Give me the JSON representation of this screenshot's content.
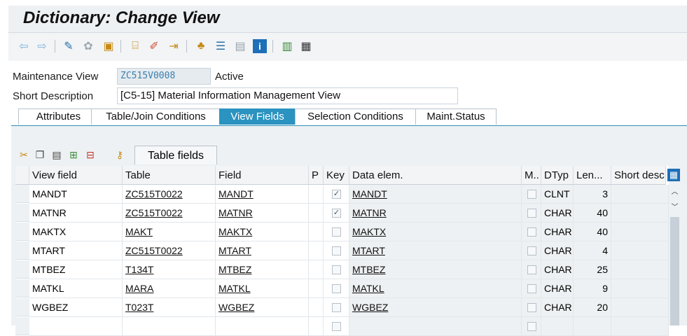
{
  "window": {
    "title": "Dictionary: Change View"
  },
  "toolbar": {
    "icons": [
      "back-arrow-icon",
      "forward-arrow-icon",
      "other-object-icon",
      "display-change-icon",
      "activate-icon",
      "where-used-icon",
      "navigation-object-icon",
      "generate-icon",
      "hierarchy-icon",
      "stack-icon",
      "layout-icon",
      "info-icon",
      "technical-settings-icon",
      "table-layout-icon"
    ]
  },
  "header": {
    "maintenance_view_label": "Maintenance View",
    "maintenance_view_value": "ZC515V0008",
    "status": "Active",
    "short_description_label": "Short Description",
    "short_description_value": "[C5-15] Material Information Management View"
  },
  "tabs": [
    {
      "label": "Attributes",
      "active": false
    },
    {
      "label": "Table/Join Conditions",
      "active": false
    },
    {
      "label": "View Fields",
      "active": true
    },
    {
      "label": "Selection Conditions",
      "active": false
    },
    {
      "label": "Maint.Status",
      "active": false
    }
  ],
  "panel": {
    "table_fields_label": "Table fields"
  },
  "grid": {
    "columns": [
      "View field",
      "Table",
      "Field",
      "P",
      "Key",
      "Data elem.",
      "M..",
      "DTyp",
      "Len...",
      "Short desc"
    ],
    "rows": [
      {
        "view_field": "MANDT",
        "table": "ZC515T0022",
        "field": "MANDT",
        "key": true,
        "data_elem": "MANDT",
        "dtyp": "CLNT",
        "len": "3"
      },
      {
        "view_field": "MATNR",
        "table": "ZC515T0022",
        "field": "MATNR",
        "key": true,
        "data_elem": "MATNR",
        "dtyp": "CHAR",
        "len": "40"
      },
      {
        "view_field": "MAKTX",
        "table": "MAKT",
        "field": "MAKTX",
        "key": false,
        "data_elem": "MAKTX",
        "dtyp": "CHAR",
        "len": "40"
      },
      {
        "view_field": "MTART",
        "table": "ZC515T0022",
        "field": "MTART",
        "key": false,
        "data_elem": "MTART",
        "dtyp": "CHAR",
        "len": "4"
      },
      {
        "view_field": "MTBEZ",
        "table": "T134T",
        "field": "MTBEZ",
        "key": false,
        "data_elem": "MTBEZ",
        "dtyp": "CHAR",
        "len": "25"
      },
      {
        "view_field": "MATKL",
        "table": "MARA",
        "field": "MATKL",
        "key": false,
        "data_elem": "MATKL",
        "dtyp": "CHAR",
        "len": "9"
      },
      {
        "view_field": "WGBEZ",
        "table": "T023T",
        "field": "WGBEZ",
        "key": false,
        "data_elem": "WGBEZ",
        "dtyp": "CHAR",
        "len": "20"
      }
    ]
  }
}
